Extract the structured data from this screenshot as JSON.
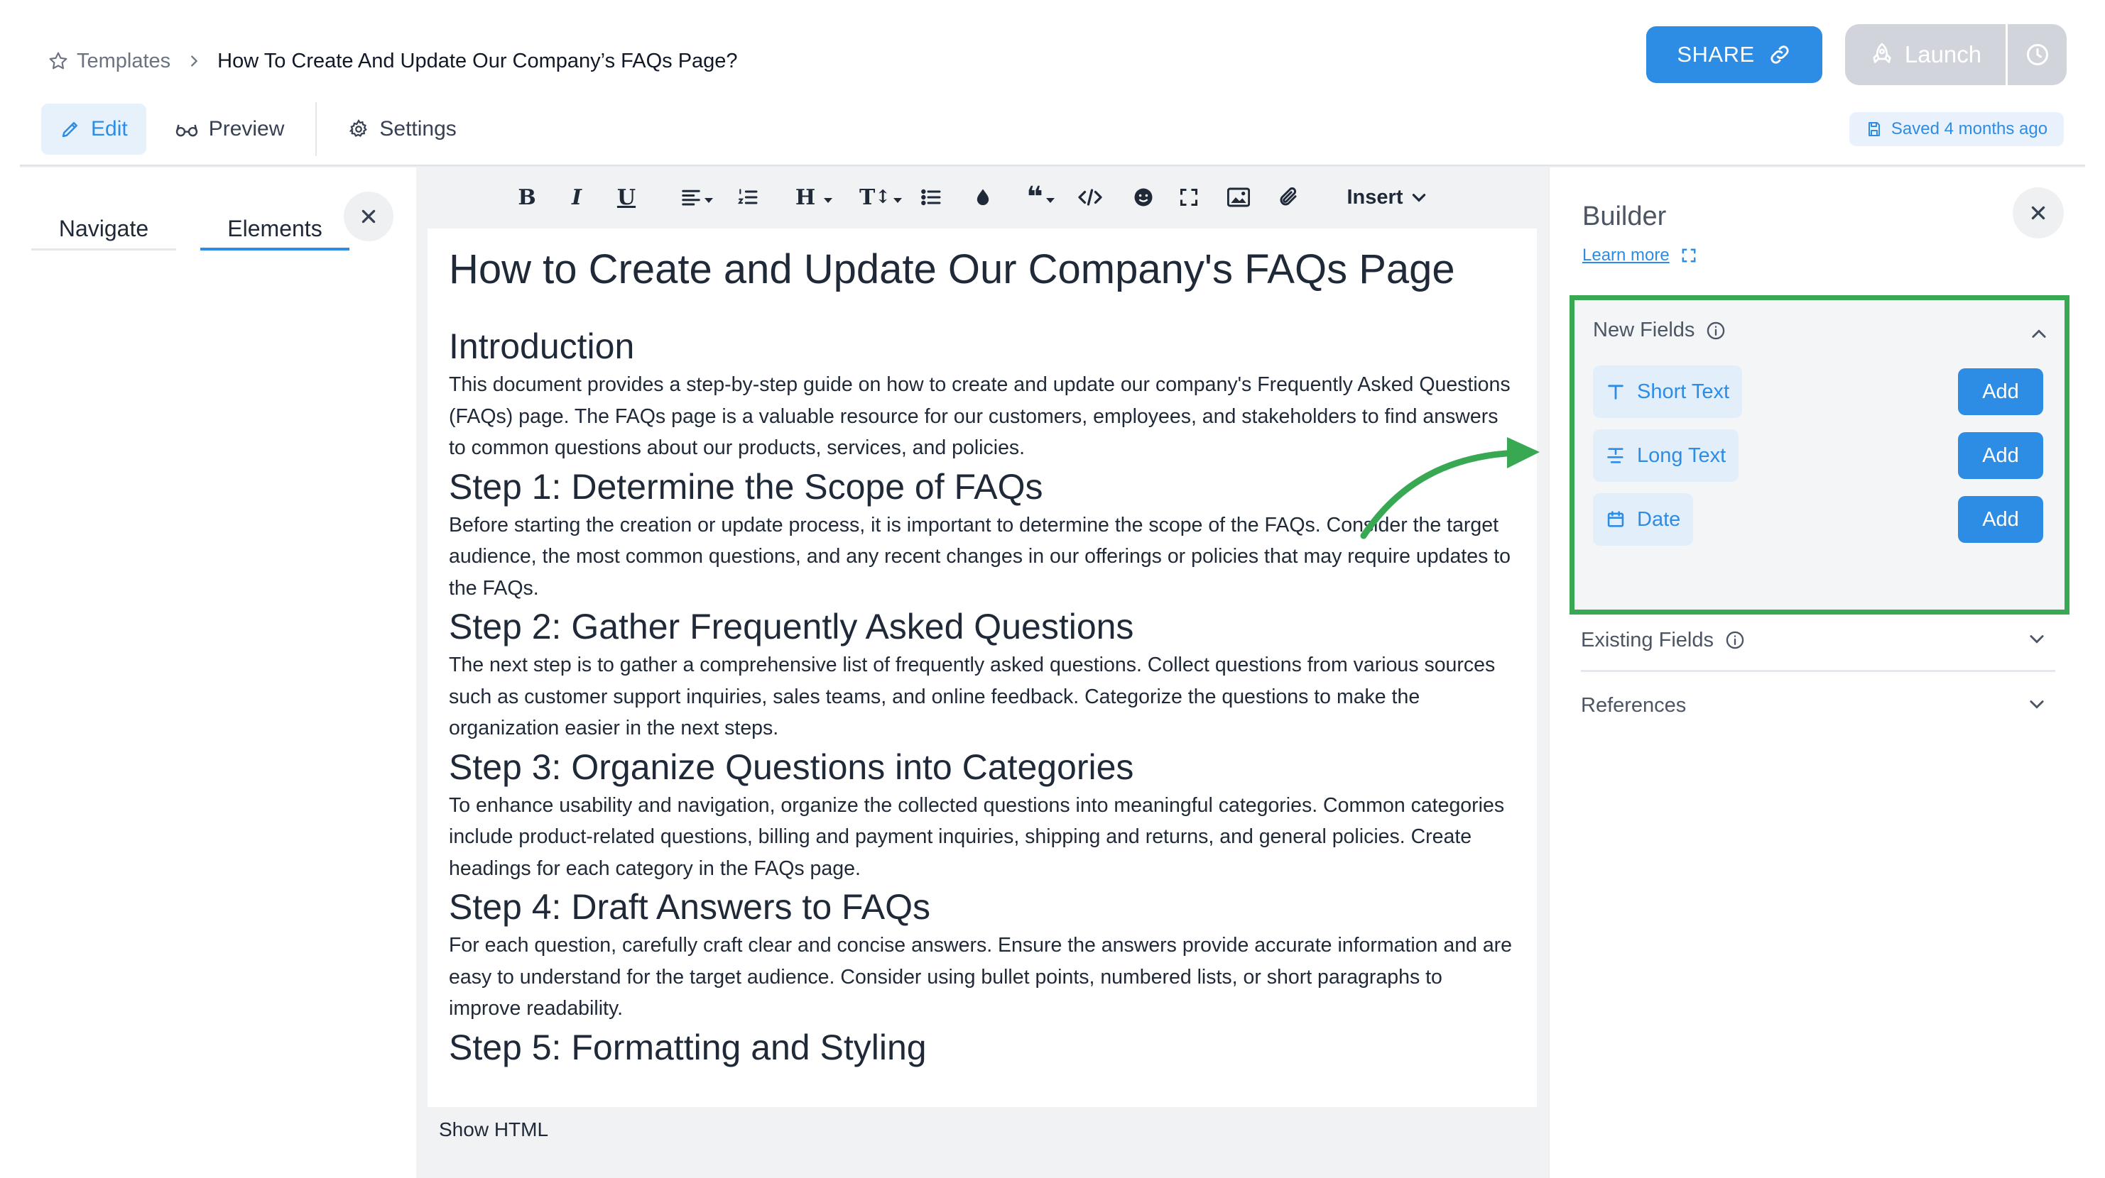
{
  "header": {
    "breadcrumb_root": "Templates",
    "breadcrumb_title": "How To Create And Update Our Company’s FAQs Page?",
    "share_label": "SHARE",
    "launch_label": "Launch",
    "tabs": [
      {
        "label": "Edit",
        "active": true
      },
      {
        "label": "Preview",
        "active": false
      },
      {
        "label": "Settings",
        "active": false
      }
    ],
    "saved_status": "Saved 4 months ago"
  },
  "left_panel": {
    "tabs": [
      {
        "label": "Navigate",
        "active": false
      },
      {
        "label": "Elements",
        "active": true
      }
    ]
  },
  "toolbar": {
    "items": [
      "bold-icon",
      "italic-icon",
      "underline-icon",
      "align-icon",
      "ordered-list-icon",
      "heading-icon",
      "font-size-icon",
      "bullet-list-icon",
      "color-drop-icon",
      "quote-icon",
      "code-icon",
      "emoji-icon",
      "fullscreen-icon",
      "image-icon",
      "attachment-icon"
    ],
    "insert_label": "Insert"
  },
  "document": {
    "title": "How to Create and Update Our Company's FAQs Page",
    "intro_heading": "Introduction",
    "intro_text": "This document provides a step-by-step guide on how to create and update our company's Frequently Asked Questions (FAQs) page. The FAQs page is a valuable resource for our customers, employees, and stakeholders to find answers to common questions about our products, services, and policies.",
    "steps": [
      {
        "heading": "Step 1: Determine the Scope of FAQs",
        "text": "Before starting the creation or update process, it is important to determine the scope of the FAQs. Consider the target audience, the most common questions, and any recent changes in our offerings or policies that may require updates to the FAQs."
      },
      {
        "heading": "Step 2: Gather Frequently Asked Questions",
        "text": "The next step is to gather a comprehensive list of frequently asked questions. Collect questions from various sources such as customer support inquiries, sales teams, and online feedback. Categorize the questions to make the organization easier in the next steps."
      },
      {
        "heading": "Step 3: Organize Questions into Categories",
        "text": "To enhance usability and navigation, organize the collected questions into meaningful categories. Common categories include product-related questions, billing and payment inquiries, shipping and returns, and general policies. Create headings for each category in the FAQs page."
      },
      {
        "heading": "Step 4: Draft Answers to FAQs",
        "text": "For each question, carefully craft clear and concise answers. Ensure the answers provide accurate information and are easy to understand for the target audience. Consider using bullet points, numbered lists, or short paragraphs to improve readability."
      },
      {
        "heading": "Step 5: Formatting and Styling",
        "text": ""
      }
    ],
    "show_html_label": "Show HTML"
  },
  "builder": {
    "title": "Builder",
    "learn_more": "Learn more",
    "new_fields": {
      "label": "New Fields",
      "items": [
        {
          "label": "Short Text",
          "icon": "text-type-icon",
          "add_label": "Add"
        },
        {
          "label": "Long Text",
          "icon": "paragraph-icon",
          "add_label": "Add"
        },
        {
          "label": "Date",
          "icon": "calendar-icon",
          "add_label": "Add"
        }
      ]
    },
    "existing_fields_label": "Existing Fields",
    "references_label": "References"
  },
  "colors": {
    "accent": "#2d8ce4",
    "highlight_border": "#38a853",
    "launch_disabled": "#d1d5db"
  }
}
